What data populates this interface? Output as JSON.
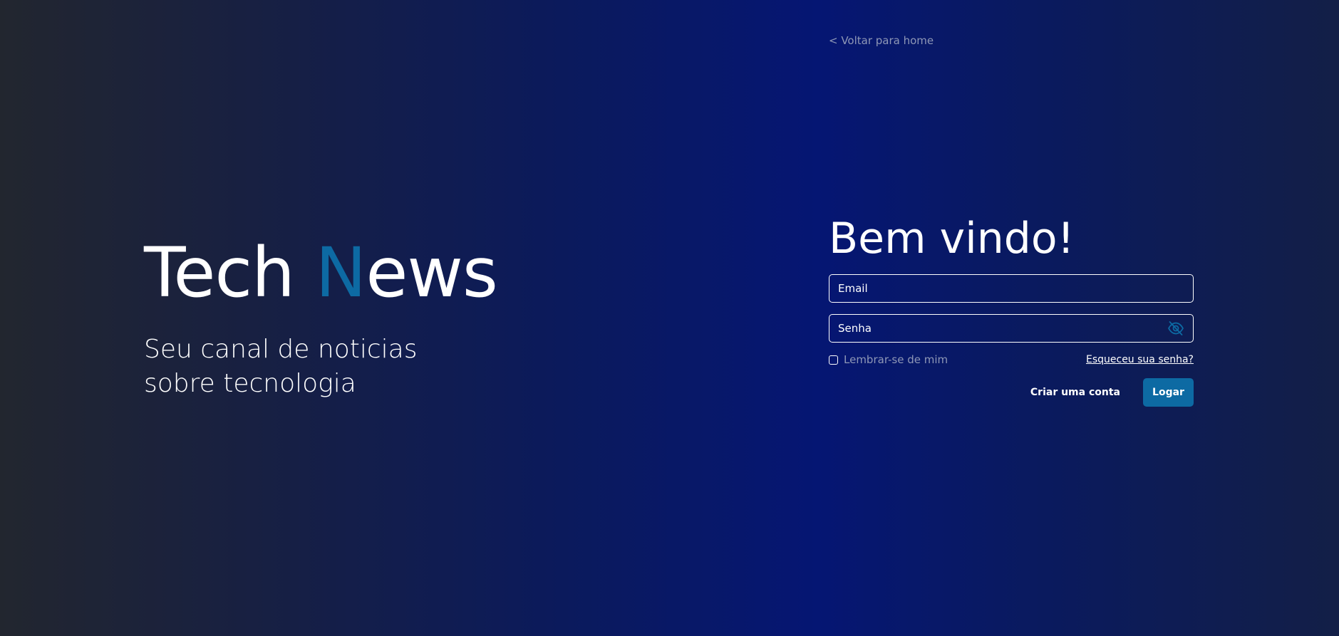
{
  "nav": {
    "back_link": "< Voltar para home"
  },
  "hero": {
    "brand_part1": "Tech ",
    "brand_accent": "N",
    "brand_part2": "ews",
    "tagline_line1": "Seu canal de noticias",
    "tagline_line2": "sobre tecnologia"
  },
  "auth": {
    "title": "Bem vindo!",
    "email_placeholder": "Email",
    "password_placeholder": "Senha",
    "remember_label": "Lembrar-se de mim",
    "forgot_link": "Esqueceu sua senha?",
    "create_account": "Criar uma conta",
    "login_button": "Logar"
  },
  "icons": {
    "password_toggle": "eye-off-icon"
  },
  "colors": {
    "accent": "#0d6aa3",
    "muted_text": "#8e97b6",
    "background_center": "#051673",
    "background_edge": "#22262f"
  }
}
